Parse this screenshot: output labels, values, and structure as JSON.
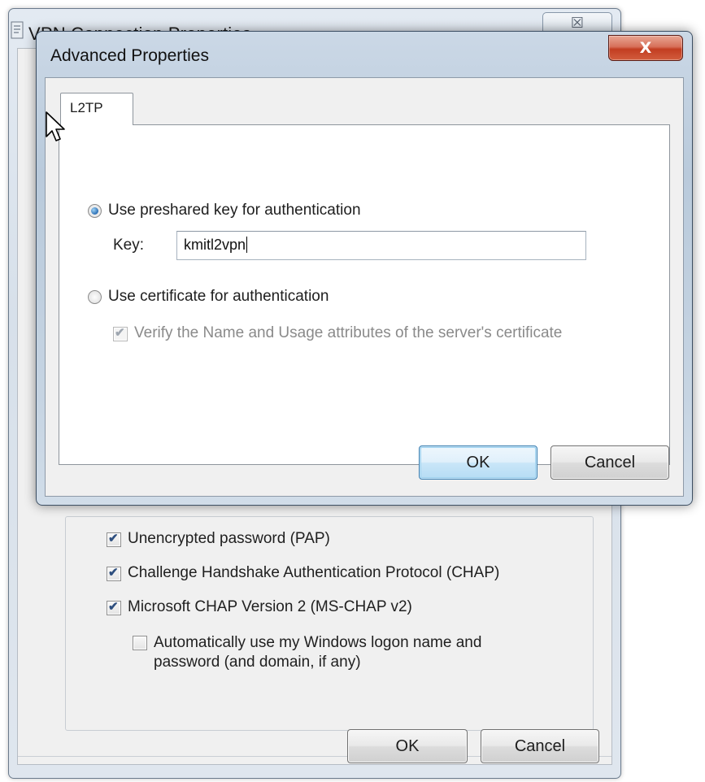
{
  "background_window": {
    "title": "VPN Connection Properties",
    "close_glyph": "☒",
    "checkboxes": [
      {
        "label": "Unencrypted password (PAP)",
        "checked": true
      },
      {
        "label": "Challenge Handshake Authentication Protocol (CHAP)",
        "checked": true
      },
      {
        "label": "Microsoft CHAP Version 2 (MS-CHAP v2)",
        "checked": true
      }
    ],
    "auto_logon": {
      "line1": "Automatically use my Windows logon name and",
      "line2": "password (and domain, if any)",
      "checked": false
    },
    "ok_label": "OK",
    "cancel_label": "Cancel"
  },
  "dialog": {
    "title": "Advanced Properties",
    "close_glyph": "X",
    "tab_label": "L2TP",
    "preshared_option": {
      "label": "Use preshared key for authentication",
      "selected": true
    },
    "key_label": "Key:",
    "key_value": "kmitl2vpn",
    "certificate_option": {
      "label": "Use certificate for authentication",
      "selected": false
    },
    "verify_checkbox": {
      "label": "Verify the Name and Usage attributes of the server's certificate",
      "checked": true,
      "enabled": false
    },
    "ok_label": "OK",
    "cancel_label": "Cancel"
  },
  "icons": {
    "window_icon": "vpn-document-icon",
    "cursor": "mouse-pointer-icon",
    "checkmark": "checkmark-icon"
  },
  "colors": {
    "close_button_red": "#c23d21",
    "radio_selected_blue": "#2a6eb4",
    "default_button_border": "#3c7fb1"
  }
}
